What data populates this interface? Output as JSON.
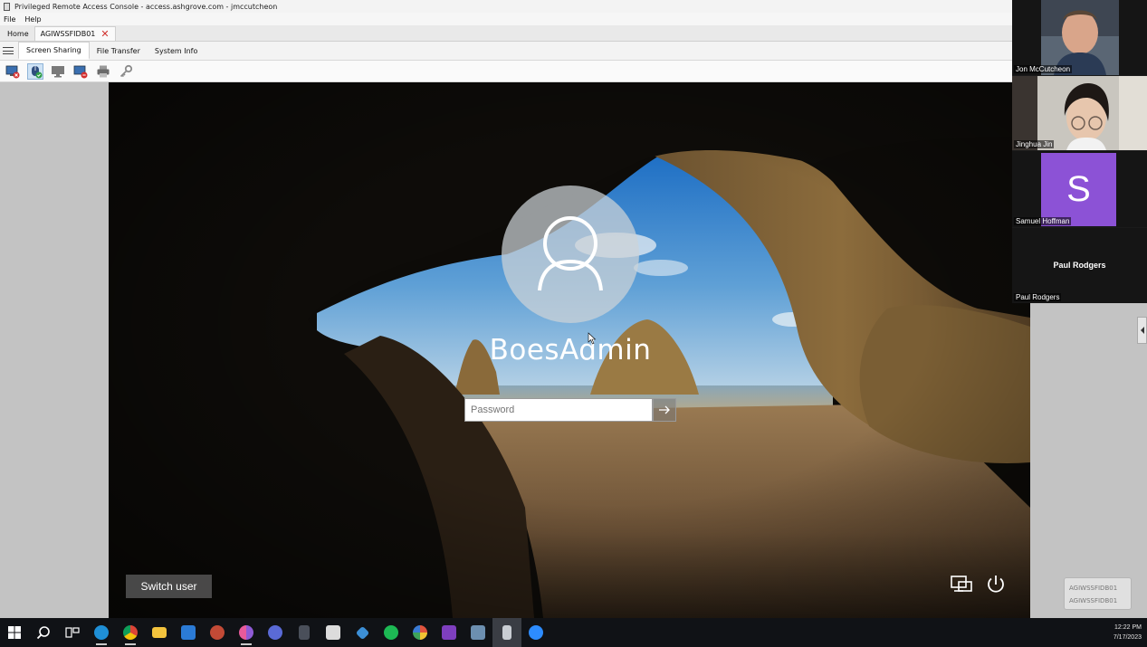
{
  "window": {
    "title": "Privileged Remote Access Console - access.ashgrove.com - jmccutcheon"
  },
  "menu": {
    "file": "File",
    "help": "Help"
  },
  "tabs": [
    {
      "label": "Home"
    },
    {
      "label": "AGIWSSFIDB01"
    }
  ],
  "subtabs": [
    {
      "label": "Screen Sharing"
    },
    {
      "label": "File Transfer"
    },
    {
      "label": "System Info"
    }
  ],
  "toolbar": {
    "icons": [
      "stop-sharing-icon",
      "control-mouse-icon",
      "monitor-icon",
      "privacy-screen-icon",
      "printer-icon",
      "key-icon"
    ]
  },
  "lockscreen": {
    "username": "BoesAdmin",
    "password_placeholder": "Password",
    "switch_user": "Switch user"
  },
  "session_badge": {
    "line1": "AGIWSSFIDB01",
    "line2": "AGIWSSFIDB01"
  },
  "participants": [
    {
      "name": "Jon McCutcheon"
    },
    {
      "name": "Jinghua Jin"
    },
    {
      "name": "Samuel Hoffman",
      "initial": "S",
      "color": "#8c52d6"
    },
    {
      "name": "Paul Rodgers",
      "center_label": "Paul Rodgers"
    }
  ],
  "taskbar": {
    "icons": [
      "start-icon",
      "search-icon",
      "task-view-icon",
      "edge-icon",
      "chrome-icon",
      "file-explorer-icon",
      "store-icon",
      "app-icon",
      "chrome-profile-icon",
      "media-icon",
      "calculator-icon",
      "snip-icon",
      "vscode-icon",
      "spotify-icon",
      "paint-icon",
      "onenote-icon",
      "network-icon",
      "remote-access-icon",
      "zoom-icon"
    ],
    "time": "12:22 PM",
    "date": "7/17/2023"
  }
}
